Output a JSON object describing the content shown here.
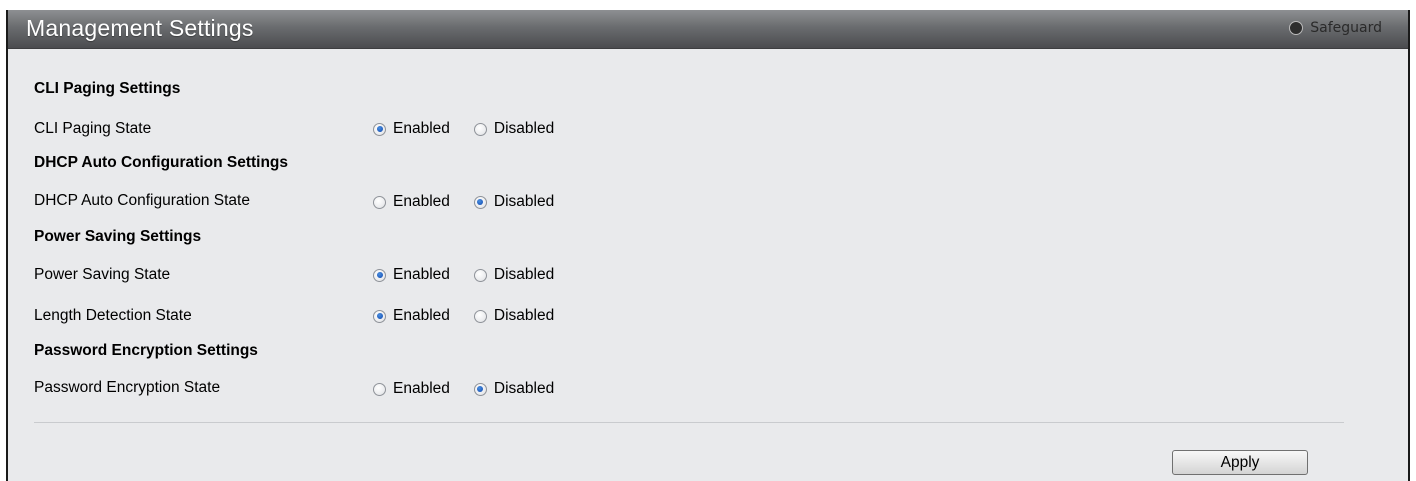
{
  "header": {
    "title": "Management Settings",
    "safeguard_label": "Safeguard"
  },
  "sections": [
    {
      "heading": "CLI Paging Settings",
      "rows": [
        {
          "label": "CLI Paging State",
          "options": [
            "Enabled",
            "Disabled"
          ],
          "selected": "Enabled"
        }
      ]
    },
    {
      "heading": "DHCP Auto Configuration Settings",
      "rows": [
        {
          "label": "DHCP Auto Configuration State",
          "options": [
            "Enabled",
            "Disabled"
          ],
          "selected": "Disabled"
        }
      ]
    },
    {
      "heading": "Power Saving Settings",
      "rows": [
        {
          "label": "Power Saving State",
          "options": [
            "Enabled",
            "Disabled"
          ],
          "selected": "Enabled"
        },
        {
          "label": "Length Detection State",
          "options": [
            "Enabled",
            "Disabled"
          ],
          "selected": "Enabled"
        }
      ]
    },
    {
      "heading": "Password Encryption Settings",
      "rows": [
        {
          "label": "Password Encryption State",
          "options": [
            "Enabled",
            "Disabled"
          ],
          "selected": "Disabled"
        }
      ]
    }
  ],
  "footer": {
    "apply_label": "Apply"
  },
  "colors": {
    "title_bar": "#6a6c6f",
    "panel_bg": "#e9eaec",
    "radio_dot": "#1b56b8"
  }
}
